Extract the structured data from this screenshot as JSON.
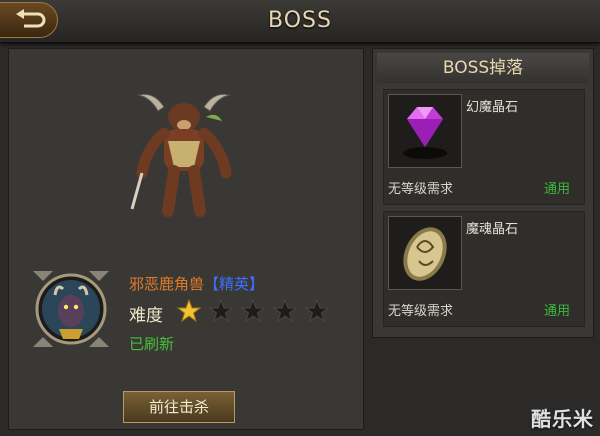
{
  "header": {
    "title": "BOSS"
  },
  "boss": {
    "name": "邪恶鹿角兽",
    "rank": "【精英】",
    "difficulty_label": "难度",
    "difficulty_rating": 1,
    "difficulty_max": 5,
    "status": "已刷新",
    "action_label": "前往击杀"
  },
  "drops": {
    "title": "BOSS掉落",
    "items": [
      {
        "name": "幻魔晶石",
        "requirement": "无等级需求",
        "usage": "通用",
        "icon": "purple-gem-icon"
      },
      {
        "name": "魔魂晶石",
        "requirement": "无等级需求",
        "usage": "通用",
        "icon": "oval-rune-stone-icon"
      }
    ]
  },
  "watermark": "酷乐米",
  "colors": {
    "name": "#e07b2a",
    "rank": "#3d6fff",
    "status": "#46c03a",
    "star_on": "#f2c230"
  }
}
